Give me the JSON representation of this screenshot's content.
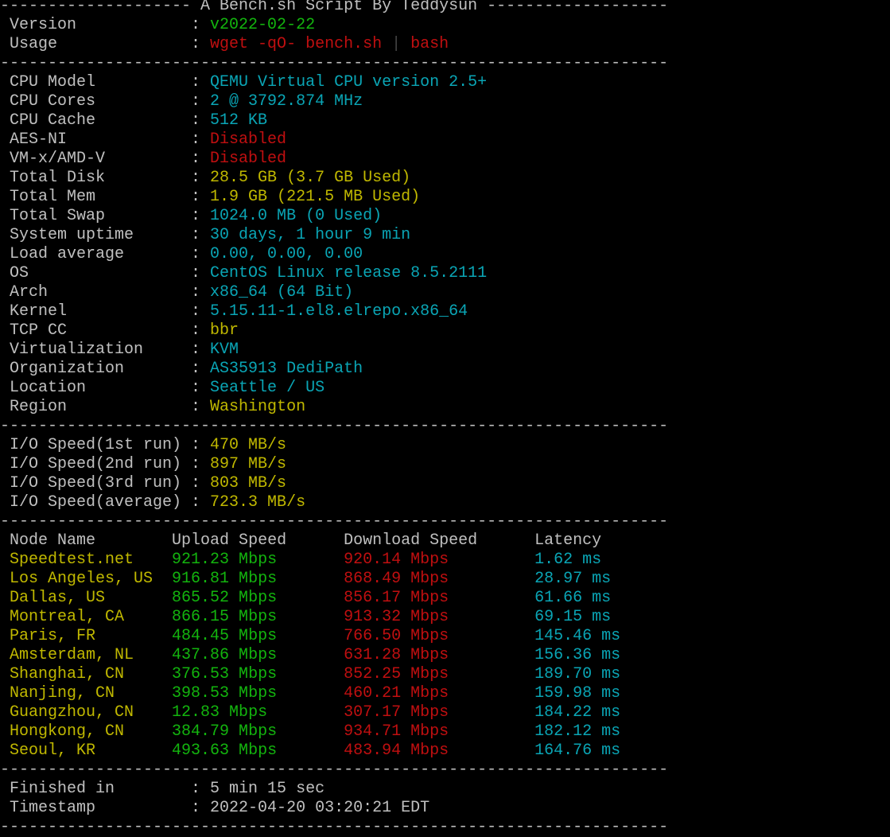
{
  "colors": {
    "grey": "#c0c0c0",
    "green": "#13b40e",
    "red": "#c00f10",
    "cyan": "#0aa5b5",
    "yellow": "#c0b800"
  },
  "title": "A Bench.sh Script By Teddysun",
  "header": [
    {
      "label": "Version",
      "value": "v2022-02-22",
      "color": "green"
    },
    {
      "label": "Usage",
      "value": "wget -qO- bench.sh | bash",
      "color": "red"
    }
  ],
  "system": [
    {
      "label": "CPU Model",
      "value": "QEMU Virtual CPU version 2.5+",
      "color": "cyan"
    },
    {
      "label": "CPU Cores",
      "value": "2 @ 3792.874 MHz",
      "color": "cyan"
    },
    {
      "label": "CPU Cache",
      "value": "512 KB",
      "color": "cyan"
    },
    {
      "label": "AES-NI",
      "value": "Disabled",
      "color": "red"
    },
    {
      "label": "VM-x/AMD-V",
      "value": "Disabled",
      "color": "red"
    },
    {
      "label": "Total Disk",
      "value": "28.5 GB (3.7 GB Used)",
      "color": "yellow"
    },
    {
      "label": "Total Mem",
      "value": "1.9 GB (221.5 MB Used)",
      "color": "yellow"
    },
    {
      "label": "Total Swap",
      "value": "1024.0 MB (0 Used)",
      "color": "cyan"
    },
    {
      "label": "System uptime",
      "value": "30 days, 1 hour 9 min",
      "color": "cyan"
    },
    {
      "label": "Load average",
      "value": "0.00, 0.00, 0.00",
      "color": "cyan"
    },
    {
      "label": "OS",
      "value": "CentOS Linux release 8.5.2111",
      "color": "cyan"
    },
    {
      "label": "Arch",
      "value": "x86_64 (64 Bit)",
      "color": "cyan"
    },
    {
      "label": "Kernel",
      "value": "5.15.11-1.el8.elrepo.x86_64",
      "color": "cyan"
    },
    {
      "label": "TCP CC",
      "value": "bbr",
      "color": "yellow"
    },
    {
      "label": "Virtualization",
      "value": "KVM",
      "color": "cyan"
    },
    {
      "label": "Organization",
      "value": "AS35913 DediPath",
      "color": "cyan"
    },
    {
      "label": "Location",
      "value": "Seattle / US",
      "color": "cyan"
    },
    {
      "label": "Region",
      "value": "Washington",
      "color": "yellow"
    }
  ],
  "io": [
    {
      "label": "I/O Speed(1st run)",
      "value": "470 MB/s",
      "color": "yellow"
    },
    {
      "label": "I/O Speed(2nd run)",
      "value": "897 MB/s",
      "color": "yellow"
    },
    {
      "label": "I/O Speed(3rd run)",
      "value": "803 MB/s",
      "color": "yellow"
    },
    {
      "label": "I/O Speed(average)",
      "value": "723.3 MB/s",
      "color": "yellow"
    }
  ],
  "speed_headers": [
    "Node Name",
    "Upload Speed",
    "Download Speed",
    "Latency"
  ],
  "speed_rows": [
    [
      "Speedtest.net",
      "921.23 Mbps",
      "920.14 Mbps",
      "1.62 ms"
    ],
    [
      "Los Angeles, US",
      "916.81 Mbps",
      "868.49 Mbps",
      "28.97 ms"
    ],
    [
      "Dallas, US",
      "865.52 Mbps",
      "856.17 Mbps",
      "61.66 ms"
    ],
    [
      "Montreal, CA",
      "866.15 Mbps",
      "913.32 Mbps",
      "69.15 ms"
    ],
    [
      "Paris, FR",
      "484.45 Mbps",
      "766.50 Mbps",
      "145.46 ms"
    ],
    [
      "Amsterdam, NL",
      "437.86 Mbps",
      "631.28 Mbps",
      "156.36 ms"
    ],
    [
      "Shanghai, CN",
      "376.53 Mbps",
      "852.25 Mbps",
      "189.70 ms"
    ],
    [
      "Nanjing, CN",
      "398.53 Mbps",
      "460.21 Mbps",
      "159.98 ms"
    ],
    [
      "Guangzhou, CN",
      "12.83 Mbps",
      "307.17 Mbps",
      "184.22 ms"
    ],
    [
      "Hongkong, CN",
      "384.79 Mbps",
      "934.71 Mbps",
      "182.12 ms"
    ],
    [
      "Seoul, KR",
      "493.63 Mbps",
      "483.94 Mbps",
      "164.76 ms"
    ]
  ],
  "footer": [
    {
      "label": "Finished in",
      "value": "5 min 15 sec",
      "color": "grey"
    },
    {
      "label": "Timestamp",
      "value": "2022-04-20 03:20:21 EDT",
      "color": "grey"
    }
  ]
}
